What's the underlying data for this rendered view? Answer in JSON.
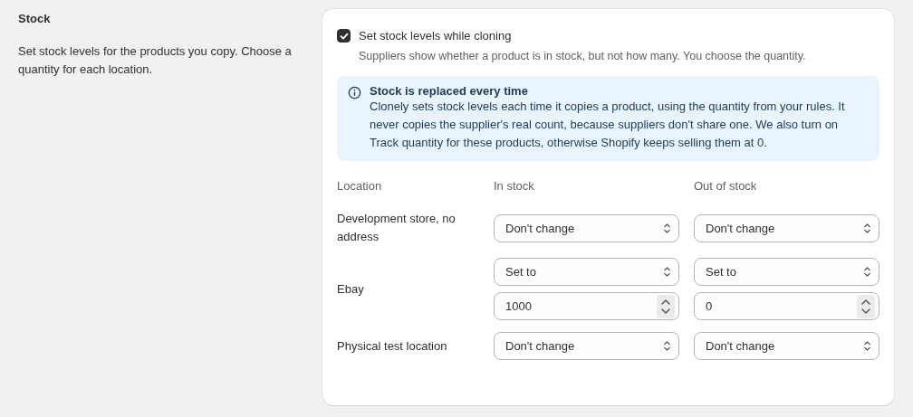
{
  "section": {
    "title": "Stock",
    "description": "Set stock levels for the products you copy. Choose a quantity for each location."
  },
  "setting": {
    "label": "Set stock levels while cloning",
    "checked": true,
    "help": "Suppliers show whether a product is in stock, but not how many. You choose the quantity."
  },
  "banner": {
    "title": "Stock is replaced every time",
    "text": "Clonely sets stock levels each time it copies a product, using the quantity from your rules. It never copies the supplier's real count, because suppliers don't share one. We also turn on Track quantity for these products, otherwise Shopify keeps selling them at 0."
  },
  "table": {
    "columns": [
      "Location",
      "In stock",
      "Out of stock"
    ],
    "rows": [
      {
        "location": "Development store, no address",
        "in_stock": {
          "select": "Don't change"
        },
        "out_of_stock": {
          "select": "Don't change"
        }
      },
      {
        "location": "Ebay",
        "in_stock": {
          "select": "Set to",
          "quantity": "1000"
        },
        "out_of_stock": {
          "select": "Set to",
          "quantity": "0"
        }
      },
      {
        "location": "Physical test location",
        "in_stock": {
          "select": "Don't change"
        },
        "out_of_stock": {
          "select": "Don't change"
        }
      }
    ]
  }
}
